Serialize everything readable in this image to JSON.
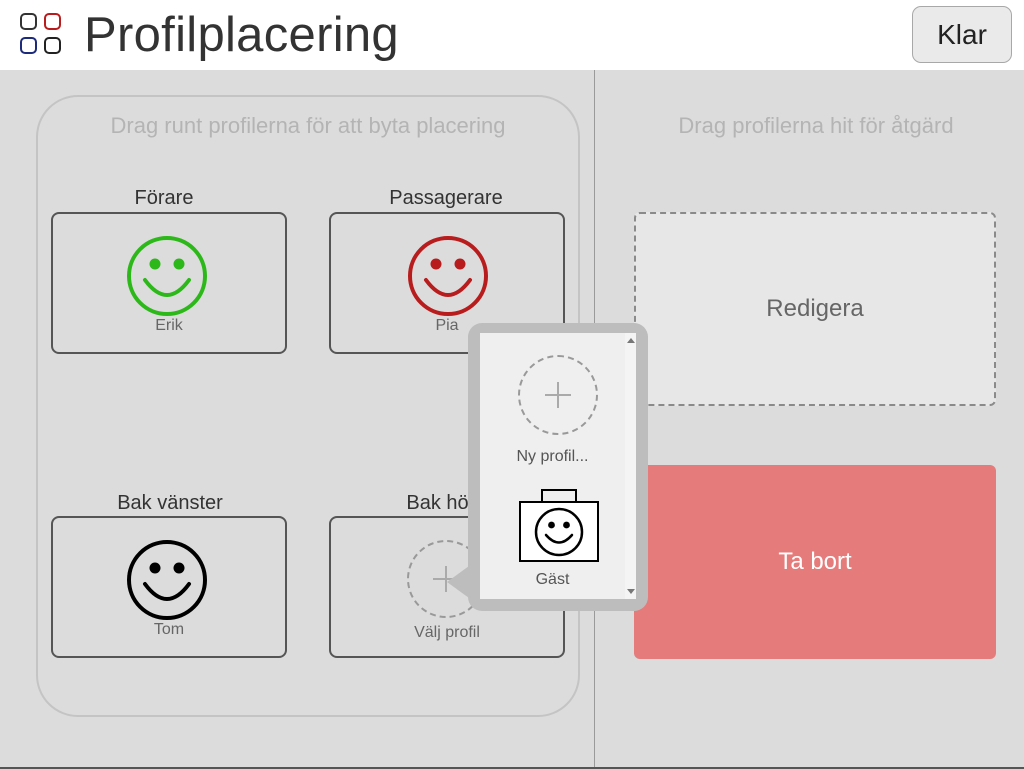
{
  "header": {
    "title": "Profilplacering",
    "done_label": "Klar"
  },
  "seat_area": {
    "hint": "Drag runt profilerna för att byta placering",
    "seats": [
      {
        "label": "Förare",
        "profile": "Erik",
        "icon": "smiley-face-icon",
        "color": "#2db81a"
      },
      {
        "label": "Passagerare",
        "profile": "Pia",
        "icon": "smiley-face-icon",
        "color": "#b81c1c"
      },
      {
        "label": "Bak vänster",
        "profile": "Tom",
        "icon": "smiley-face-icon",
        "color": "#000000"
      },
      {
        "label": "Bak höger",
        "profile": "Välj profil",
        "icon": "add-profile-icon",
        "color": "#999999"
      }
    ]
  },
  "action_area": {
    "hint": "Drag profilerna hit för åtgärd",
    "edit_label": "Redigera",
    "remove_label": "Ta bort",
    "remove_color": "#e57b7b"
  },
  "profile_picker": {
    "new_profile_label": "Ny profil...",
    "guest_label": "Gäst"
  }
}
